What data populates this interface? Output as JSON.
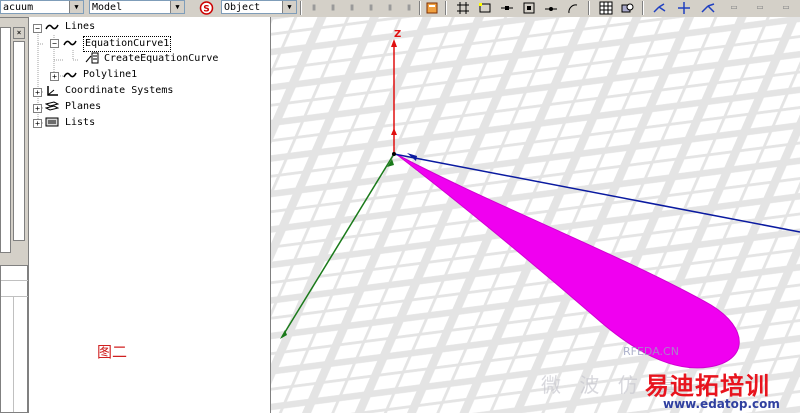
{
  "toolbar": {
    "material_combo": "acuum",
    "model_combo": "Model",
    "snap_combo": "Object"
  },
  "tree": {
    "items": [
      {
        "label": "Lines"
      },
      {
        "label": "EquationCurve1"
      },
      {
        "label": "CreateEquationCurve"
      },
      {
        "label": "Polyline1"
      },
      {
        "label": "Coordinate Systems"
      },
      {
        "label": "Planes"
      },
      {
        "label": "Lists"
      }
    ],
    "caption": "图二"
  },
  "viewport": {
    "axis_label_z": "Z",
    "colors": {
      "z_axis": "#e01010",
      "x_axis": "#0a1aa0",
      "y_axis": "#1a7a1a",
      "lobe": "#f000f0"
    }
  },
  "watermark": {
    "site": "RFEDA.CN",
    "brand_cn": "易迪拓培训",
    "url": "www.edatop.com",
    "faded_cn": "微 波 仿 真"
  }
}
